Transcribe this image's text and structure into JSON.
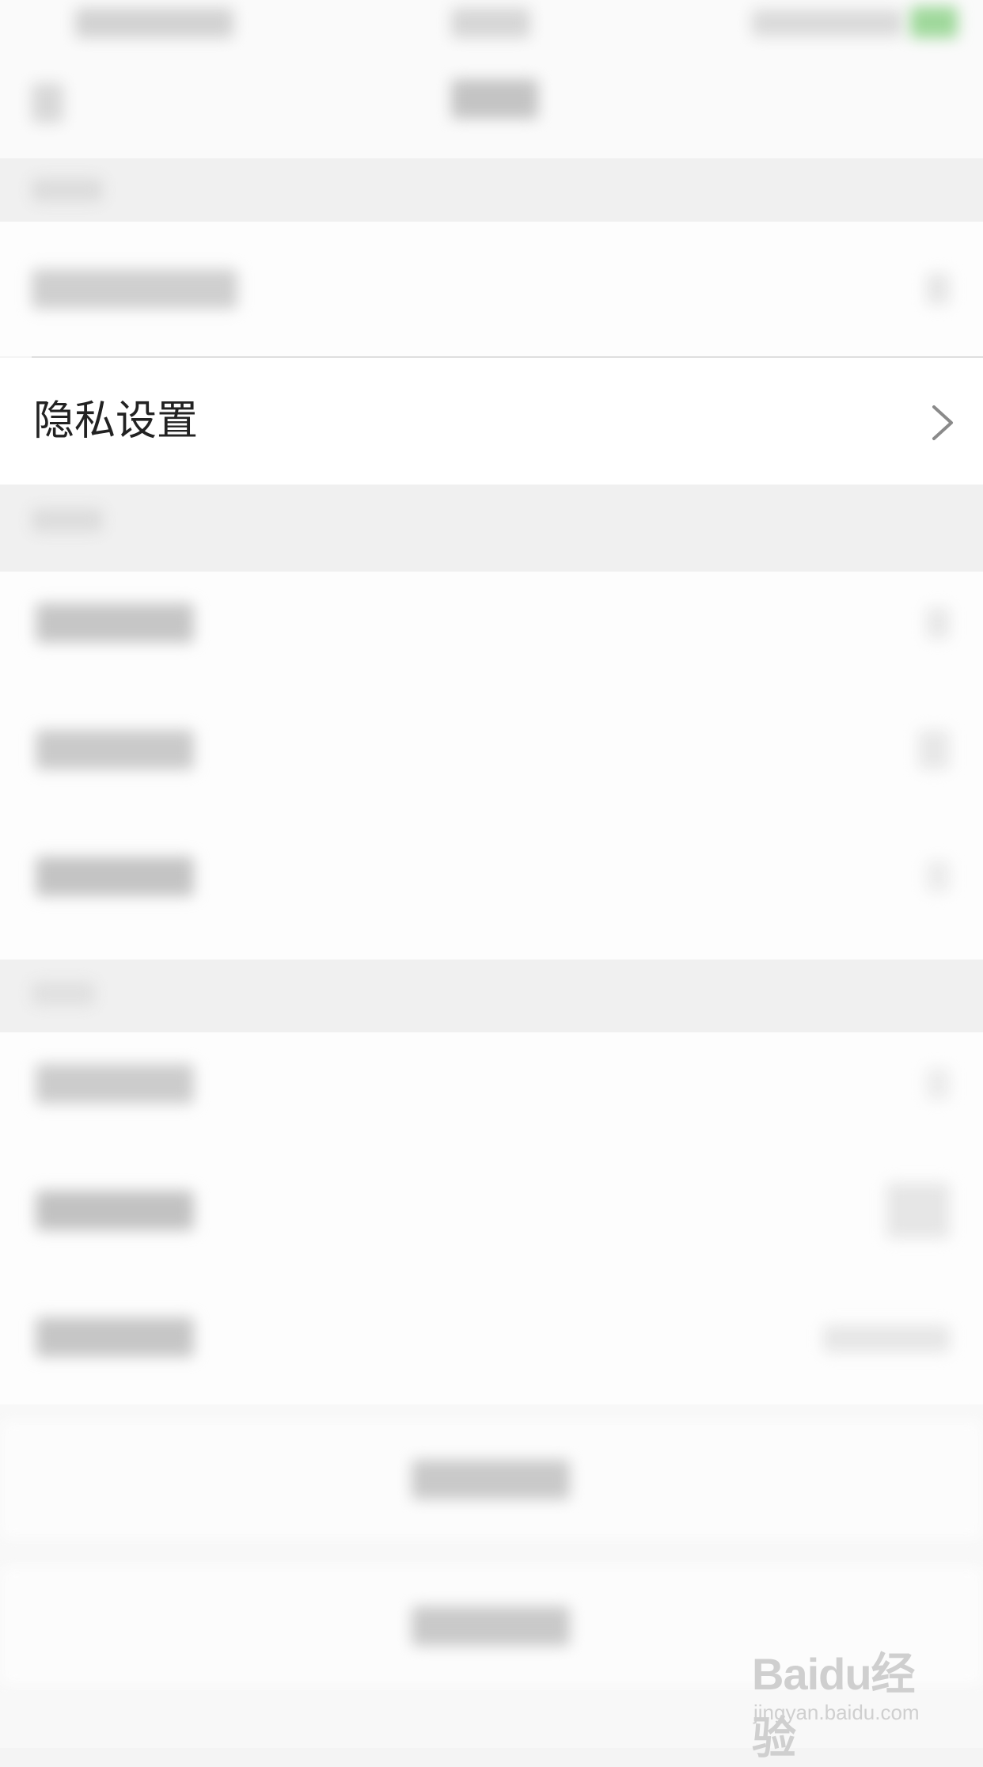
{
  "settings": {
    "privacy_label": "隐私设置",
    "chevron_icon": "chevron-right-icon"
  },
  "watermark": {
    "logo": "Baidu经验",
    "site": "jingyan.baidu.com"
  },
  "colors": {
    "background": "#f4f4f4",
    "row_background": "#ffffff",
    "text": "#222222",
    "chevron": "#8a8a8a",
    "status_accent": "#8fd18b"
  }
}
